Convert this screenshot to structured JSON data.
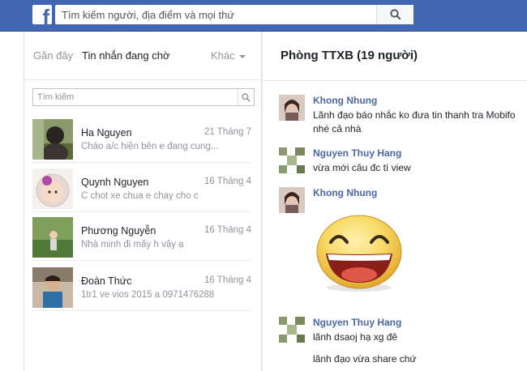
{
  "topbar": {
    "logo_letter": "f",
    "search_placeholder": "Tìm kiếm người, địa điểm và mọi thứ"
  },
  "messages_panel": {
    "tabs": {
      "recent": "Gần đây",
      "pending": "Tin nhắn đang chờ",
      "other": "Khác"
    },
    "search_placeholder": "Tìm kiếm",
    "threads": [
      {
        "name": "Ha Nguyen",
        "date": "21 Tháng 7",
        "snippet": "Chào a/c hiện bên e đang cung..."
      },
      {
        "name": "Quynh Nguyen",
        "date": "16 Tháng 4",
        "snippet": "C chot xe chua e chay cho c"
      },
      {
        "name": "Phương Nguyễn",
        "date": "16 Tháng 4",
        "snippet": "Nhà minh đi mấy h vậy ạ"
      },
      {
        "name": "Đoàn Thức",
        "date": "16 Tháng 4",
        "snippet": "1tr1 ve vios 2015 a 0971476288"
      }
    ]
  },
  "conversation": {
    "title": "Phòng TTXB (19 người)",
    "messages": [
      {
        "sender": "Khong Nhung",
        "lines": [
          "Lãnh đạo báo nhắc ko đưa tin thanh tra Mobifo",
          "nhé cả nhà"
        ]
      },
      {
        "sender": "Nguyen Thuy Hang",
        "lines": [
          "vừa mới câu đc tí view"
        ]
      },
      {
        "sender": "Khong Nhung",
        "lines": [],
        "sticker": "laughing-face-sticker"
      },
      {
        "sender": "Nguyen Thuy Hang",
        "lines": [
          "lãnh dsaoj hạ xg đê",
          "lãnh đạo vừa share chứ"
        ]
      }
    ]
  },
  "colors": {
    "brand_blue": "#4267b2",
    "sender_name": "#4b67a1",
    "muted_text": "#90949c"
  }
}
